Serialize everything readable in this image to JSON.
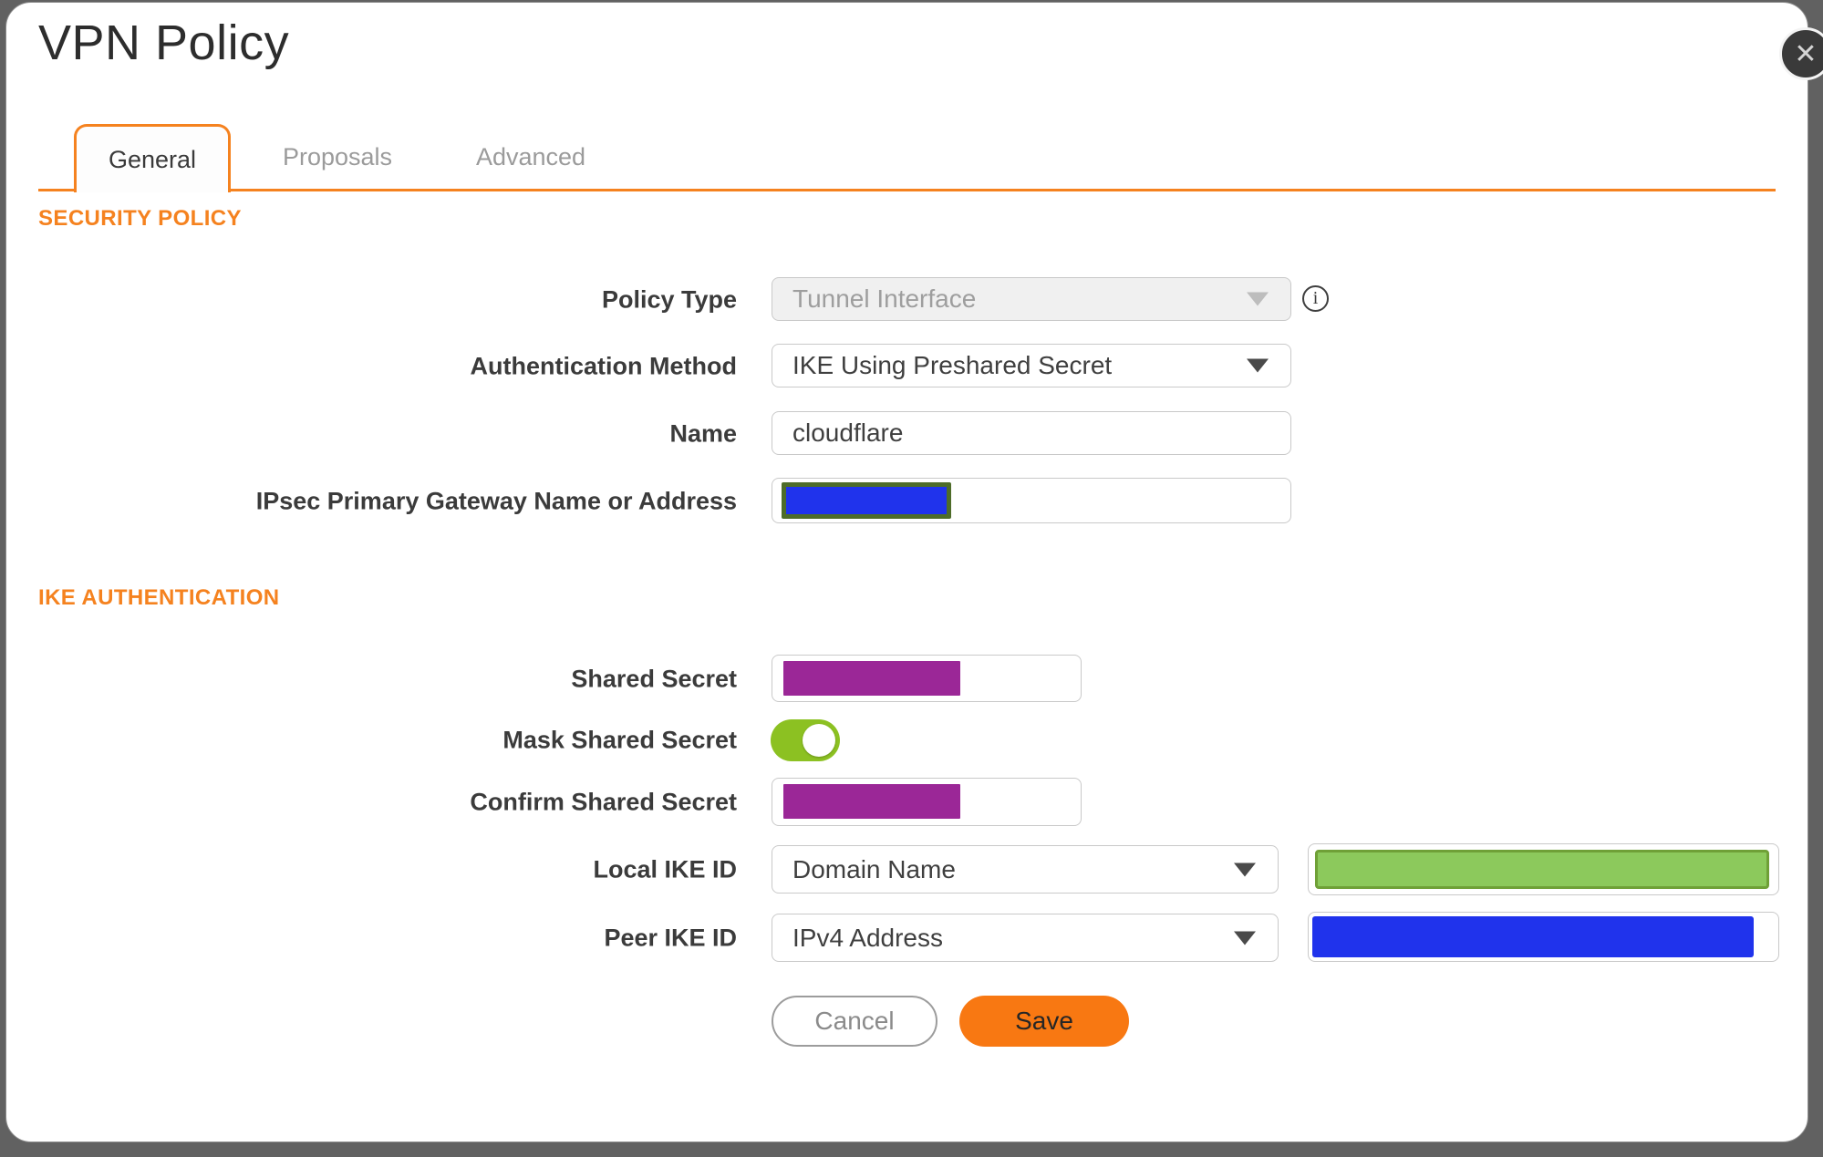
{
  "dialog": {
    "title": "VPN Policy",
    "close_glyph": "✕"
  },
  "tabs": [
    {
      "label": "General",
      "active": true
    },
    {
      "label": "Proposals",
      "active": false
    },
    {
      "label": "Advanced",
      "active": false
    }
  ],
  "sections": {
    "security_policy": "SECURITY POLICY",
    "ike_authentication": "IKE AUTHENTICATION"
  },
  "fields": {
    "policy_type": {
      "label": "Policy Type",
      "value": "Tunnel Interface",
      "disabled": true
    },
    "authentication_method": {
      "label": "Authentication Method",
      "value": "IKE Using Preshared Secret"
    },
    "name": {
      "label": "Name",
      "value": "cloudflare"
    },
    "gateway": {
      "label": "IPsec Primary Gateway Name or Address",
      "value": "",
      "redacted": true
    },
    "shared_secret": {
      "label": "Shared Secret",
      "value": "",
      "redacted": true
    },
    "mask_shared_secret": {
      "label": "Mask Shared Secret",
      "enabled": true
    },
    "confirm_shared_secret": {
      "label": "Confirm Shared Secret",
      "value": "",
      "redacted": true
    },
    "local_ike_id": {
      "label": "Local IKE ID",
      "value": "Domain Name",
      "id_value_redacted": true
    },
    "peer_ike_id": {
      "label": "Peer IKE ID",
      "value": "IPv4 Address",
      "id_value_redacted": true
    }
  },
  "icons": {
    "info_glyph": "i"
  },
  "buttons": {
    "cancel": "Cancel",
    "save": "Save"
  },
  "colors": {
    "accent_orange": "#F5821F",
    "save_orange": "#F87812",
    "toggle_green": "#8CC122",
    "redact_purple": "#9B2797",
    "redact_blue": "#2033EC",
    "redact_green_fill": "#8CC95C",
    "redact_green_border": "#6FA037",
    "redact_olive_border": "#4E6C29",
    "backdrop_gray": "#616161"
  }
}
